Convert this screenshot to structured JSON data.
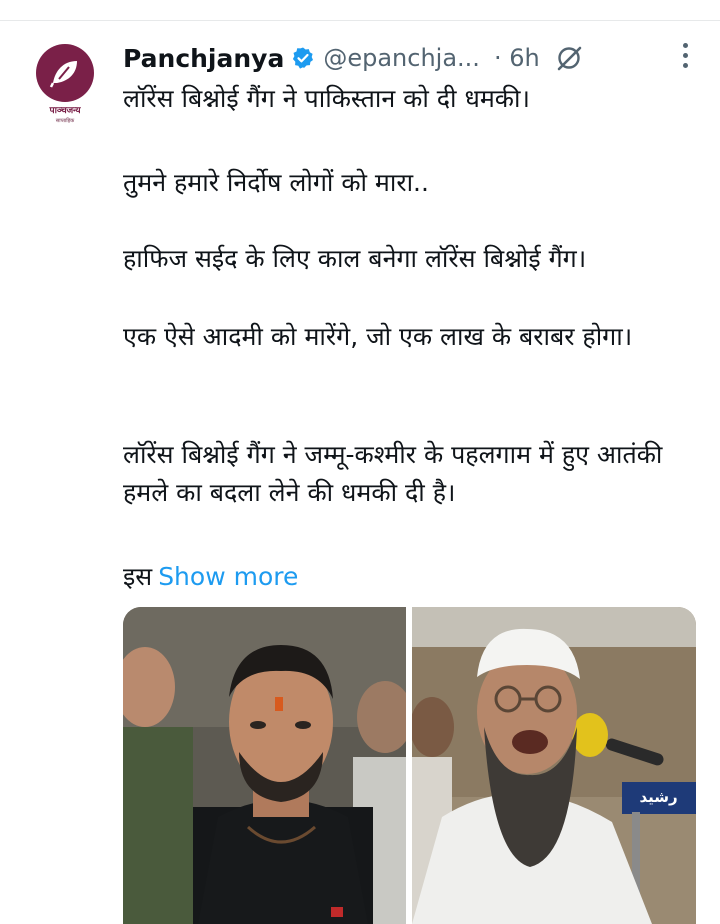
{
  "tweet": {
    "author_name": "Panchjanya",
    "handle": "@epanchja...",
    "time": "· 6h",
    "logo_text": "पाञ्चजन्य",
    "logo_tiny": "साप्ताहिक",
    "paragraphs": [
      "लॉरेंस बिश्नोई गैंग ने पाकिस्तान को दी धमकी।",
      "तुमने हमारे निर्दोष लोगों को मारा..",
      "हाफिज सईद के लिए काल बनेगा लॉरेंस बिश्नोई गैंग।",
      "एक ऐसे आदमी को मारेंगे, जो एक लाख के बराबर होगा।",
      "लॉरेंस बिश्नोई गैंग ने जम्मू-कश्मीर के पहलगाम में हुए आतंकी हमले का बदला लेने की धमकी दी है।"
    ],
    "truncated_prefix": "इस",
    "show_more_label": "Show more",
    "sign_text": "رشید"
  },
  "colors": {
    "link": "#1d9bf0",
    "verified": "#1d9bf0",
    "secondary_text": "#536471",
    "brand": "#7a2048"
  },
  "icons": [
    "verified-badge-icon",
    "grok-icon",
    "more-options-icon",
    "panchjanya-logo"
  ]
}
